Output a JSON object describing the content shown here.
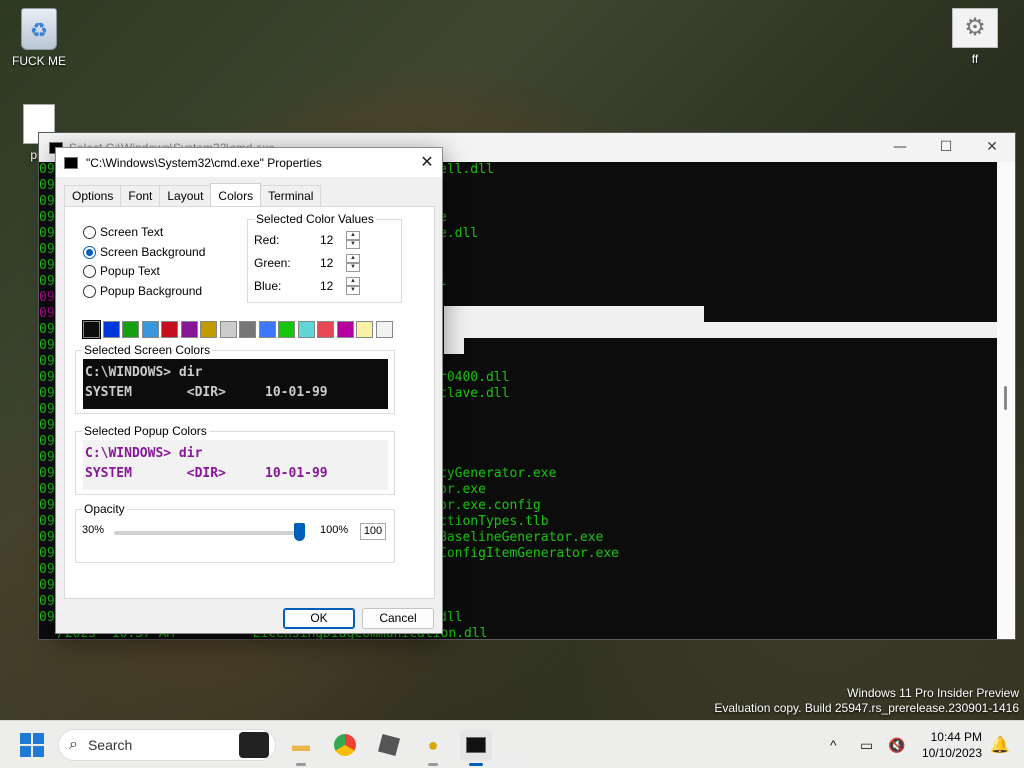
{
  "desktop": {
    "icons": [
      {
        "label": "FUCK ME",
        "icon": "recycle-bin-icon"
      },
      {
        "label": "ff",
        "icon": "gear-icon"
      },
      {
        "label": "pro",
        "icon": "document-icon"
      }
    ]
  },
  "cmd_window": {
    "title": "Select C:\\Windows\\System32\\cmd.exe",
    "controls": {
      "minimize": "—",
      "maximize": "☐",
      "close": "✕"
    },
    "line_prefix": "09",
    "visible_lines": [
      "ell.dll",
      "e",
      "e.dll",
      "l",
      "r0400.dll",
      "clave.dll",
      "cyGenerator.exe",
      "or.exe",
      "or.exe.config",
      "ctionTypes.tlb",
      "BaselineGenerator.exe",
      "ConfigItemGenerator.exe",
      "dll",
      "/2023  10:37 AM          LicensingDiagCommunication.dll"
    ]
  },
  "dialog": {
    "title": "\"C:\\Windows\\System32\\cmd.exe\" Properties",
    "close": "✕",
    "tabs": [
      "Options",
      "Font",
      "Layout",
      "Colors",
      "Terminal"
    ],
    "active_tab": "Colors",
    "radios": [
      {
        "label": "Screen Text",
        "checked": false
      },
      {
        "label": "Screen Background",
        "checked": true
      },
      {
        "label": "Popup Text",
        "checked": false
      },
      {
        "label": "Popup Background",
        "checked": false
      }
    ],
    "color_values": {
      "legend": "Selected Color Values",
      "red_label": "Red:",
      "red": "12",
      "green_label": "Green:",
      "green": "12",
      "blue_label": "Blue:",
      "blue": "12",
      "up": "▲",
      "down": "▼"
    },
    "palette": [
      "#0c0c0c",
      "#0037da",
      "#13a10e",
      "#3a96dd",
      "#c50f1f",
      "#881798",
      "#c19c00",
      "#cccccc",
      "#767676",
      "#3b78ff",
      "#16c60c",
      "#61d6d6",
      "#e74856",
      "#b4009e",
      "#f9f1a5",
      "#f2f2f2"
    ],
    "screen_colors": {
      "legend": "Selected Screen Colors",
      "line1": "C:\\WINDOWS> dir",
      "line2": "SYSTEM       <DIR>     10-01-99"
    },
    "popup_colors": {
      "legend": "Selected Popup Colors",
      "line1": "C:\\WINDOWS> dir",
      "line2": "SYSTEM       <DIR>     10-01-99"
    },
    "opacity": {
      "legend": "Opacity",
      "min_label": "30%",
      "max_label": "100%",
      "value": "100",
      "fraction": 1.0
    },
    "ok": "OK",
    "cancel": "Cancel"
  },
  "watermark": {
    "line1": "Windows 11 Pro Insider Preview",
    "line2": "Evaluation copy. Build 25947.rs_prerelease.230901-1416"
  },
  "taskbar": {
    "search_placeholder": "Search",
    "apps": [
      "file-explorer-icon",
      "chrome-icon",
      "roblox-icon",
      "bee-app-icon",
      "terminal-icon"
    ],
    "tray": {
      "chevron": "^",
      "time": "10:44 PM",
      "date": "10/10/2023"
    }
  }
}
